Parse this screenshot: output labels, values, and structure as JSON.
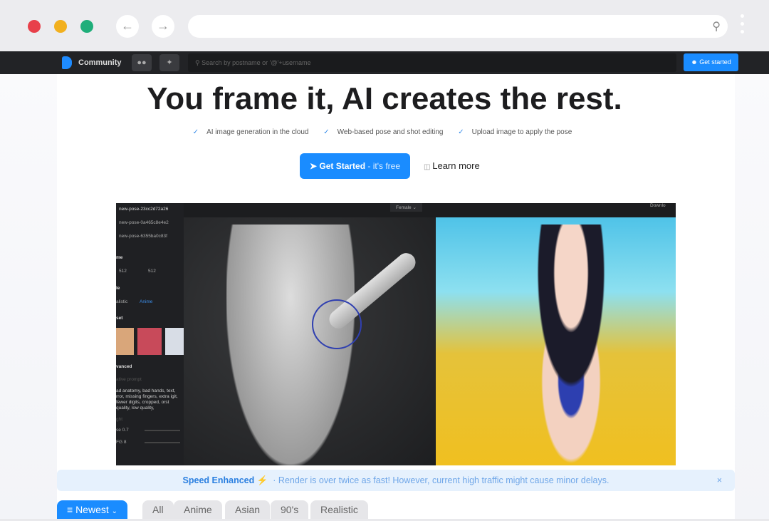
{
  "browser": {
    "back": "←",
    "forward": "→",
    "search_icon": "search-icon"
  },
  "nav": {
    "brand": "Community",
    "search_placeholder": "Search by postname or '@'+username",
    "get_started": "Get started"
  },
  "hero": {
    "title": "You frame it, AI creates the rest.",
    "features": [
      "AI image generation in the cloud",
      "Web-based pose and shot editing",
      "Upload image to apply the pose"
    ],
    "cta_main": "Get Started",
    "cta_sub": " - it's free",
    "learn_more": "Learn more"
  },
  "preview": {
    "poses": [
      "new-pose-23cc2d72a26",
      "new-pose-0a465c8e4e2",
      "new-pose-6355ba0c83f"
    ],
    "frame_label": "me",
    "width": "512",
    "height": "512",
    "style_label": "le",
    "style_realistic": "alistic",
    "style_anime": "Anime",
    "preset_label": "set",
    "advanced": "vanced",
    "neg_label": "ative prompt",
    "neg_prompt": "ad anatomy, bad hands, text, rror, missing fingers, extra igit, fewer digits, cropped, orst quality, low quality,",
    "weight_label": "ght",
    "pose_val": "se 0.7",
    "cfg_val": "FG 8",
    "gender": "Female",
    "download": "Downlo"
  },
  "banner": {
    "title": "Speed Enhanced",
    "icon": "⚡",
    "message": "· Render is over twice as fast! However, current high traffic might cause minor delays.",
    "close": "×"
  },
  "filters": {
    "sort": "Newest",
    "tags": [
      "All",
      "Anime",
      "Asian",
      "90's",
      "Realistic"
    ]
  },
  "colors": {
    "accent": "#1a8cff",
    "close": "#e8404a",
    "minimize": "#f2b01e",
    "maximize": "#1fae7a"
  }
}
